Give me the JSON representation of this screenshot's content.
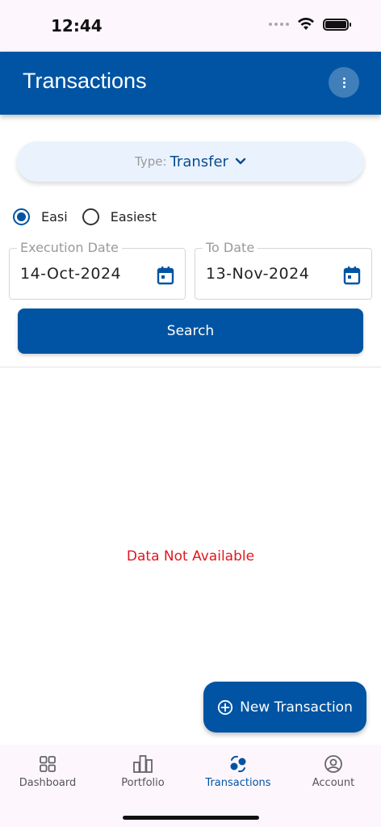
{
  "status_bar": {
    "time": "12:44"
  },
  "app_bar": {
    "title": "Transactions"
  },
  "filter": {
    "type_label": "Type:",
    "type_value": "Transfer",
    "radio_options": [
      {
        "label": "Easi",
        "selected": true
      },
      {
        "label": "Easiest",
        "selected": false
      }
    ],
    "execution_date": {
      "label": "Execution Date",
      "value": "14-Oct-2024"
    },
    "to_date": {
      "label": "To Date",
      "value": "13-Nov-2024"
    },
    "search_label": "Search"
  },
  "results": {
    "empty_message": "Data Not Available"
  },
  "fab": {
    "label": "New Transaction"
  },
  "bottom_nav": {
    "items": [
      {
        "label": "Dashboard",
        "icon": "grid-icon",
        "active": false
      },
      {
        "label": "Portfolio",
        "icon": "bar-chart-icon",
        "active": false
      },
      {
        "label": "Transactions",
        "icon": "transactions-icon",
        "active": true
      },
      {
        "label": "Account",
        "icon": "account-icon",
        "active": false
      }
    ]
  },
  "colors": {
    "primary": "#0054a3",
    "error": "#e0171f",
    "type_selector_bg": "#eaf3fd"
  }
}
